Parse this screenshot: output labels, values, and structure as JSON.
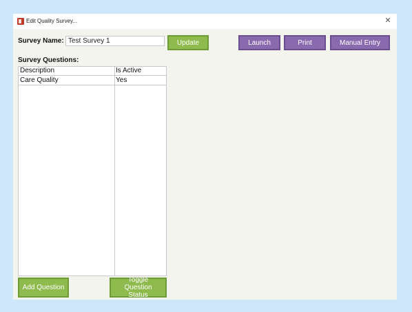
{
  "window": {
    "title": "Edit Quality Survey..."
  },
  "survey": {
    "name_label": "Survey Name:",
    "name_value": "Test Survey 1"
  },
  "buttons": {
    "update": "Update",
    "launch": "Launch",
    "print": "Print",
    "manual_entry": "Manual Entry",
    "add_question": "Add Question",
    "toggle_status": "Toggle Question Status"
  },
  "questions": {
    "label": "Survey Questions:",
    "columns": [
      "Description",
      "Is Active"
    ],
    "rows": [
      {
        "description": "Care Quality",
        "is_active": "Yes"
      }
    ]
  },
  "colors": {
    "green_button": "#8fbb4e",
    "purple_button": "#8a6aaf",
    "form_background": "#f4f4ee",
    "desktop_background": "#cfe7fb"
  }
}
